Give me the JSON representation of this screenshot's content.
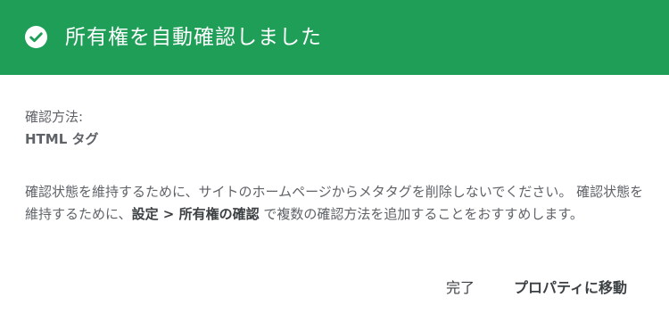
{
  "header": {
    "icon": "check-circle-icon",
    "title": "所有権を自動確認しました",
    "background_color": "#1e9e57"
  },
  "verification": {
    "method_label": "確認方法:",
    "method_value": "HTML タグ"
  },
  "message": {
    "part1": "確認状態を維持するために、サイトのホームページからメタタグを削除しないでください。 確認状態を維持するために、",
    "settings_link": "設定 > 所有権の確認",
    "part2": " で複数の確認方法を追加することをおすすめします。"
  },
  "footer": {
    "done_label": "完了",
    "goto_property_label": "プロパティに移動"
  }
}
